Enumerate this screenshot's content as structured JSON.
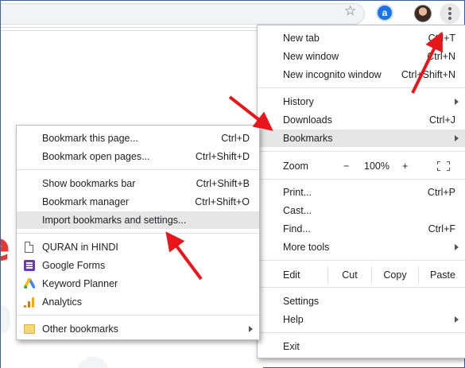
{
  "toolbar": {
    "star_icon": "star-icon",
    "extension_letter": "a",
    "avatar_icon": "profile-avatar",
    "menu_icon": "three-dot-menu-icon"
  },
  "page": {
    "partial_letter": "e"
  },
  "main_menu": {
    "group1": [
      {
        "label": "New tab",
        "shortcut": "Ctrl+T"
      },
      {
        "label": "New window",
        "shortcut": "Ctrl+N"
      },
      {
        "label": "New incognito window",
        "shortcut": "Ctrl+Shift+N"
      }
    ],
    "group2": [
      {
        "label": "History",
        "shortcut": ""
      },
      {
        "label": "Downloads",
        "shortcut": "Ctrl+J"
      },
      {
        "label": "Bookmarks",
        "shortcut": ""
      }
    ],
    "zoom": {
      "label": "Zoom",
      "minus": "−",
      "value": "100%",
      "plus": "+"
    },
    "group3": [
      {
        "label": "Print...",
        "shortcut": "Ctrl+P"
      },
      {
        "label": "Cast...",
        "shortcut": ""
      },
      {
        "label": "Find...",
        "shortcut": "Ctrl+F"
      },
      {
        "label": "More tools",
        "shortcut": ""
      }
    ],
    "edit": {
      "label": "Edit",
      "cut": "Cut",
      "copy": "Copy",
      "paste": "Paste"
    },
    "group4": [
      {
        "label": "Settings",
        "shortcut": ""
      },
      {
        "label": "Help",
        "shortcut": ""
      }
    ],
    "exit": {
      "label": "Exit"
    }
  },
  "bookmarks_menu": {
    "group1": [
      {
        "label": "Bookmark this page...",
        "shortcut": "Ctrl+D"
      },
      {
        "label": "Bookmark open pages...",
        "shortcut": "Ctrl+Shift+D"
      }
    ],
    "group2": [
      {
        "label": "Show bookmarks bar",
        "shortcut": "Ctrl+Shift+B"
      },
      {
        "label": "Bookmark manager",
        "shortcut": "Ctrl+Shift+O"
      },
      {
        "label": "Import bookmarks and settings...",
        "shortcut": ""
      }
    ],
    "bookmarks": [
      {
        "label": "QURAN in HINDI",
        "icon": "document-icon"
      },
      {
        "label": "Google Forms",
        "icon": "google-forms-icon"
      },
      {
        "label": "Keyword Planner",
        "icon": "google-ads-icon"
      },
      {
        "label": "Analytics",
        "icon": "google-analytics-icon"
      }
    ],
    "other": {
      "label": "Other bookmarks",
      "icon": "folder-icon"
    }
  },
  "colors": {
    "highlight": "#e6e6e6",
    "annotation_arrow": "#e8151b",
    "forms_purple": "#673ab7"
  }
}
